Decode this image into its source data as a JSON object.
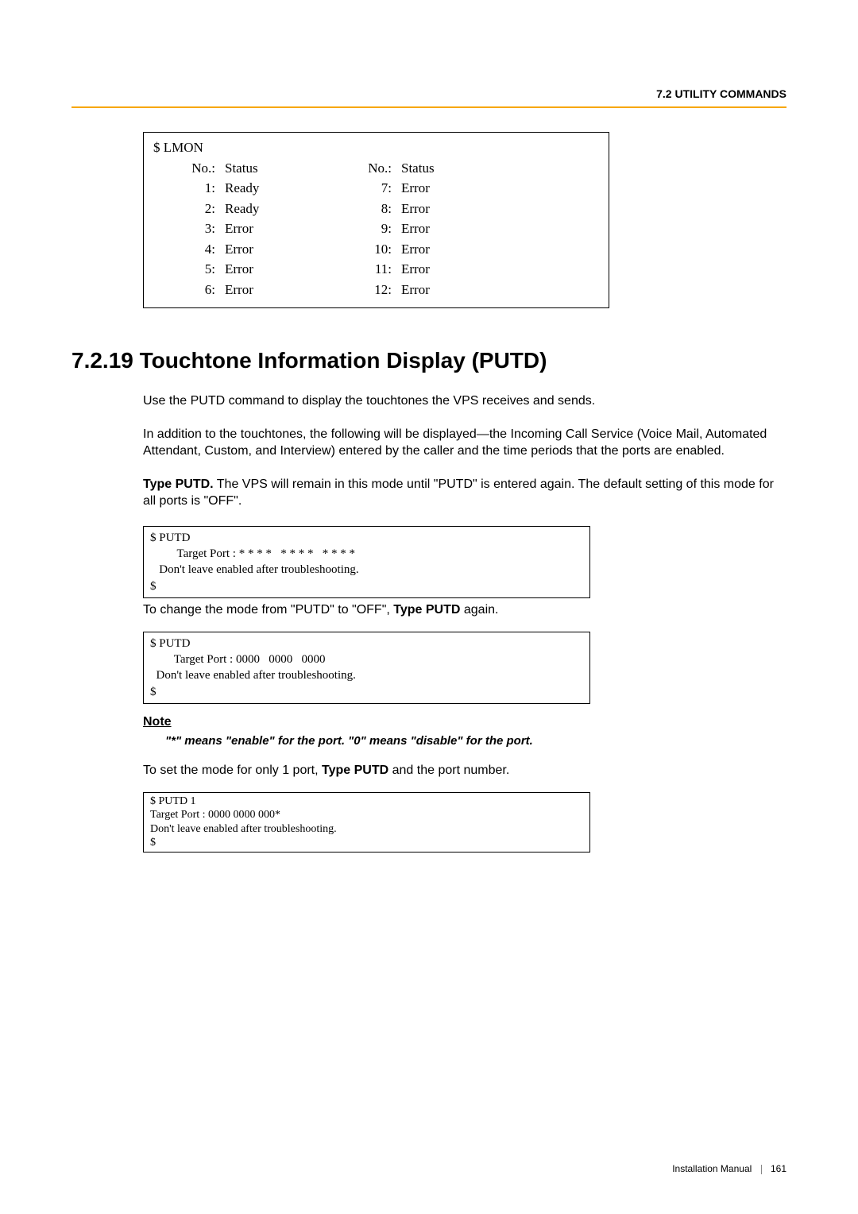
{
  "header": "7.2 UTILITY COMMANDS",
  "lmon": {
    "cmd": "$ LMON",
    "headers": {
      "no": "No.:",
      "status": "Status"
    },
    "left": [
      {
        "no": "1:",
        "status": "Ready"
      },
      {
        "no": "2:",
        "status": "Ready"
      },
      {
        "no": "3:",
        "status": "Error"
      },
      {
        "no": "4:",
        "status": "Error"
      },
      {
        "no": "5:",
        "status": "Error"
      },
      {
        "no": "6:",
        "status": "Error"
      }
    ],
    "right": [
      {
        "no": "7:",
        "status": "Error"
      },
      {
        "no": "8:",
        "status": "Error"
      },
      {
        "no": "9:",
        "status": "Error"
      },
      {
        "no": "10:",
        "status": "Error"
      },
      {
        "no": "11:",
        "status": "Error"
      },
      {
        "no": "12:",
        "status": "Error"
      }
    ]
  },
  "section": {
    "num": "7.2.19",
    "title": "Touchtone Information Display (PUTD)",
    "p1": "Use the PUTD command to display the touchtones the VPS receives and sends.",
    "p2": "In addition to the touchtones, the following will be displayed—the Incoming Call Service (Voice Mail, Automated Attendant, Custom, and Interview) entered by the caller and the time periods that the ports are enabled.",
    "p3_strong": "Type PUTD.",
    "p3_rest": " The VPS will remain in this mode until \"PUTD\" is entered again. The default setting of this mode for all ports is \"OFF\"."
  },
  "putd_on": {
    "l1": "$ PUTD",
    "l2": "         Target Port : * * * *   * * * *   * * * *",
    "l3": "   Don't leave enabled after troubleshooting.",
    "l4": "$"
  },
  "after_on_pre": "To change the mode from \"PUTD\" to \"OFF\", ",
  "after_on_strong": "Type PUTD",
  "after_on_post": " again.",
  "putd_off": {
    "l1": "$ PUTD",
    "l2": "        Target Port : 0000   0000   0000",
    "l3": "  Don't leave enabled after troubleshooting.",
    "l4": "$"
  },
  "note": {
    "title": "Note",
    "body": "\"*\" means \"enable\" for the port. \"0\" means \"disable\" for the port."
  },
  "set_one_pre": "To set the mode for only 1 port, ",
  "set_one_strong": "Type PUTD",
  "set_one_post": " and the port number.",
  "putd1": {
    "l1": "$ PUTD 1",
    "l2": "       Target Port : 0000   0000   000*",
    "l3": "   Don't leave enabled after troubleshooting.",
    "l4": "$"
  },
  "footer": {
    "label": "Installation Manual",
    "page": "161"
  }
}
